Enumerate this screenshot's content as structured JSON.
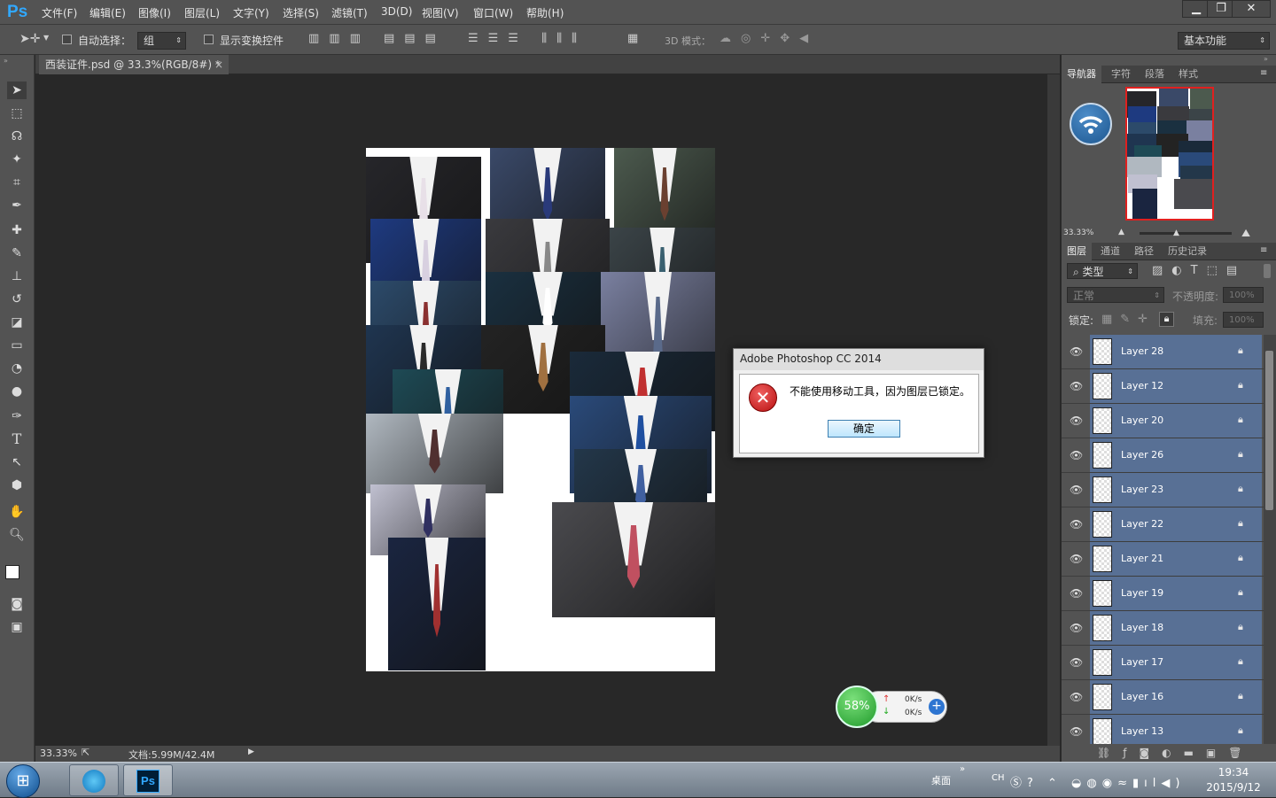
{
  "app": {
    "logo": "Ps"
  },
  "menu": [
    "文件(F)",
    "编辑(E)",
    "图像(I)",
    "图层(L)",
    "文字(Y)",
    "选择(S)",
    "滤镜(T)",
    "3D(D)",
    "视图(V)",
    "窗口(W)",
    "帮助(H)"
  ],
  "window_controls": {
    "minimize": "▁",
    "restore": "❐",
    "close": "✕"
  },
  "options": {
    "auto_select_label": "自动选择：",
    "auto_select_value": "组",
    "show_transform_label": "显示变换控件",
    "mode3d_label": "3D 模式：",
    "workspace": "基本功能"
  },
  "document": {
    "tab_title": "西装证件.psd @ 33.3%(RGB/8#) *",
    "tab_close": "×",
    "zoom": "33.33%",
    "doc_size": "文档:5.99M/42.4M"
  },
  "dialog": {
    "title": "Adobe Photoshop CC 2014",
    "message": "不能使用移动工具，因为图层已锁定。",
    "ok": "确定",
    "icon": "error-icon"
  },
  "net_widget": {
    "percent": "58%",
    "up": "0K/s",
    "down": "0K/s"
  },
  "panels": {
    "top_tabs": [
      "导航器",
      "字符",
      "段落",
      "样式"
    ],
    "nav_zoom": "33.33%",
    "layer_tabs": [
      "图层",
      "通道",
      "路径",
      "历史记录"
    ],
    "kind_filter": "类型",
    "blend_mode": "正常",
    "opacity_label": "不透明度:",
    "opacity_value": "100%",
    "lock_label": "锁定:",
    "fill_label": "填充:",
    "fill_value": "100%"
  },
  "layers": [
    "Layer 28",
    "Layer 12",
    "Layer 20",
    "Layer 26",
    "Layer 23",
    "Layer 22",
    "Layer 21",
    "Layer 19",
    "Layer 18",
    "Layer 17",
    "Layer 16",
    "Layer 13"
  ],
  "taskbar": {
    "desktop_label": "桌面",
    "ime": "CH",
    "time": "19:34",
    "date": "2015/9/12"
  },
  "colors": {
    "accent": "#31a8ff",
    "layer_selected": "#587095",
    "error": "#c41818"
  }
}
